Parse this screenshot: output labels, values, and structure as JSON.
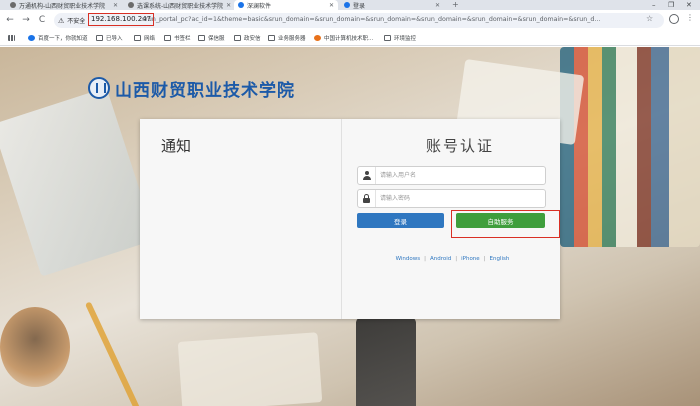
{
  "browser": {
    "tabs": [
      {
        "title": "万通机构-山西财贸职业技术学院",
        "active": false,
        "favicon_color": "#6b6b6b"
      },
      {
        "title": "选课系统-山西财贸职业技术学院",
        "active": false,
        "favicon_color": "#6b6b6b"
      },
      {
        "title": "深澜软件",
        "active": true,
        "favicon_color": "#1a73e8"
      },
      {
        "title": "登录",
        "active": false,
        "favicon_color": "#1a73e8"
      }
    ],
    "new_tab_label": "+",
    "window_controls": {
      "minimize": "–",
      "restore": "❐",
      "close": "✕"
    },
    "nav": {
      "back": "←",
      "forward": "→",
      "reload": "C"
    },
    "security_label": "不安全",
    "url_host": "192.168.100.247",
    "url_rest": "srun_portal_pc?ac_id=1&theme=basic&srun_domain=&srun_domain=&srun_domain=&srun_domain=&srun_domain=&srun_domain=&srun_d...",
    "bookmarks": [
      {
        "label": "百度一下，你就知道",
        "icon": "baidu-icon"
      },
      {
        "label": "已导入",
        "icon": "folder-icon"
      },
      {
        "label": "网络",
        "icon": "folder-icon"
      },
      {
        "label": "书签栏",
        "icon": "folder-icon"
      },
      {
        "label": "保信服",
        "icon": "folder-icon"
      },
      {
        "label": "政安信",
        "icon": "folder-icon"
      },
      {
        "label": "业务服务器",
        "icon": "folder-icon"
      },
      {
        "label": "中国计算机技术职...",
        "icon": "site-icon"
      },
      {
        "label": "环境监控",
        "icon": "folder-icon"
      }
    ]
  },
  "page": {
    "school_name": "山西财贸职业技术学院",
    "notice_title": "通知",
    "auth_title": "账号认证",
    "username_placeholder": "请输入用户名",
    "password_placeholder": "请输入密码",
    "login_button": "登录",
    "self_service_button": "自助服务",
    "clients": [
      "Windows",
      "Android",
      "iPhone",
      "English"
    ],
    "client_separator": "|",
    "colors": {
      "primary": "#2f77c0",
      "success": "#3f9e3c",
      "highlight": "#d93025",
      "brand": "#1c5aa8"
    }
  }
}
